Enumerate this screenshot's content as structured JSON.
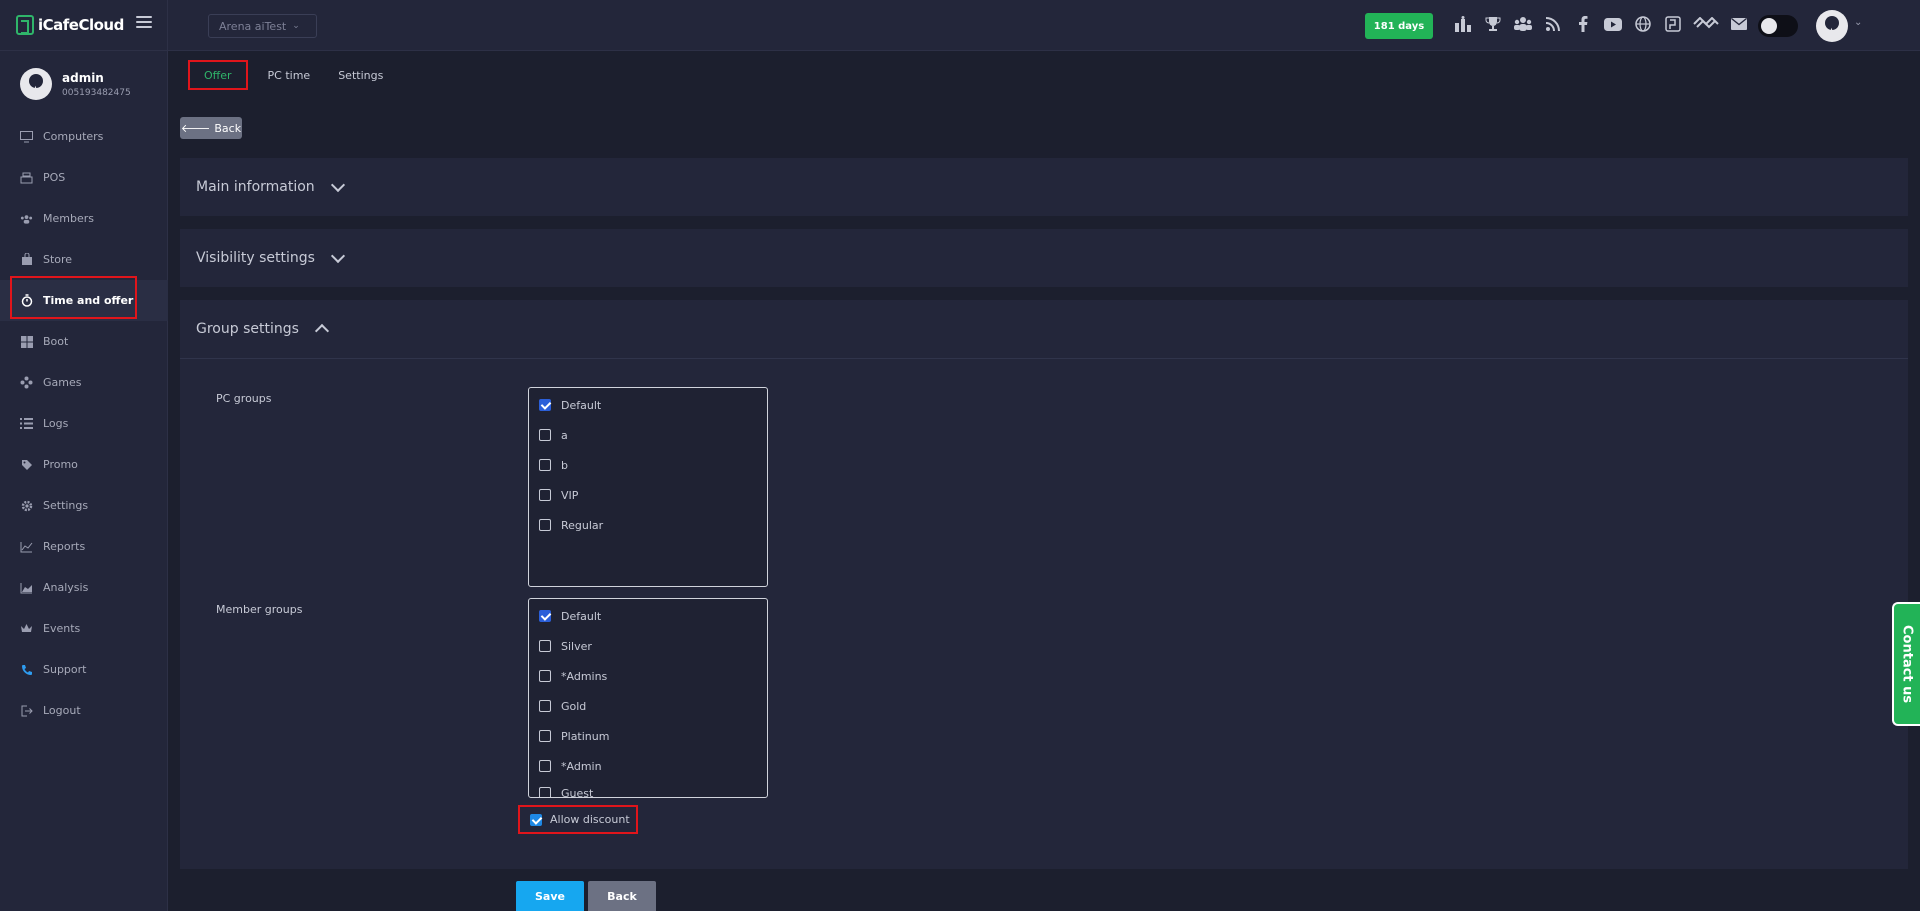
{
  "app": {
    "name": "iCafeCloud"
  },
  "user": {
    "name": "admin",
    "id": "005193482475"
  },
  "sidebar": {
    "items": [
      {
        "label": "Computers",
        "icon": "monitor-icon"
      },
      {
        "label": "POS",
        "icon": "register-icon"
      },
      {
        "label": "Members",
        "icon": "users-icon"
      },
      {
        "label": "Store",
        "icon": "bag-icon"
      },
      {
        "label": "Time and offer",
        "icon": "stopwatch-icon",
        "active": true
      },
      {
        "label": "Boot",
        "icon": "windows-icon"
      },
      {
        "label": "Games",
        "icon": "gamepad-icon"
      },
      {
        "label": "Logs",
        "icon": "list-icon"
      },
      {
        "label": "Promo",
        "icon": "tag-icon"
      },
      {
        "label": "Settings",
        "icon": "gear-icon"
      },
      {
        "label": "Reports",
        "icon": "line-chart-icon"
      },
      {
        "label": "Analysis",
        "icon": "area-chart-icon"
      },
      {
        "label": "Events",
        "icon": "crown-icon"
      },
      {
        "label": "Support",
        "icon": "phone-icon"
      },
      {
        "label": "Logout",
        "icon": "logout-icon"
      }
    ]
  },
  "header": {
    "branch": "Arena aiTest",
    "days": "181 days",
    "icons": [
      "ranking-icon",
      "trophy-icon",
      "group-icon",
      "rss-icon",
      "facebook-icon",
      "youtube-icon",
      "globe-icon",
      "icafe-icon",
      "handshake-icon",
      "mail-icon"
    ]
  },
  "tabs": [
    {
      "label": "Offer",
      "active": true
    },
    {
      "label": "PC time"
    },
    {
      "label": "Settings"
    }
  ],
  "back_top": "Back",
  "sections": {
    "main": "Main information",
    "visibility": "Visibility settings",
    "group": "Group settings"
  },
  "pc_groups": {
    "label": "PC groups",
    "options": [
      {
        "label": "Default",
        "checked": true
      },
      {
        "label": "a",
        "checked": false
      },
      {
        "label": "b",
        "checked": false
      },
      {
        "label": "VIP",
        "checked": false
      },
      {
        "label": "Regular",
        "checked": false
      }
    ]
  },
  "member_groups": {
    "label": "Member groups",
    "options": [
      {
        "label": "Default",
        "checked": true
      },
      {
        "label": "Silver",
        "checked": false
      },
      {
        "label": "*Admins",
        "checked": false
      },
      {
        "label": "Gold",
        "checked": false
      },
      {
        "label": "Platinum",
        "checked": false
      },
      {
        "label": "*Admin",
        "checked": false
      },
      {
        "label": "Guest",
        "checked": false
      }
    ]
  },
  "allow_discount": {
    "label": "Allow discount",
    "checked": true
  },
  "buttons": {
    "save": "Save",
    "back": "Back"
  },
  "contact": "Contact us",
  "colors": {
    "accent_green": "#22b357",
    "save_blue": "#16a7f0",
    "highlight_red": "#e0151b"
  }
}
